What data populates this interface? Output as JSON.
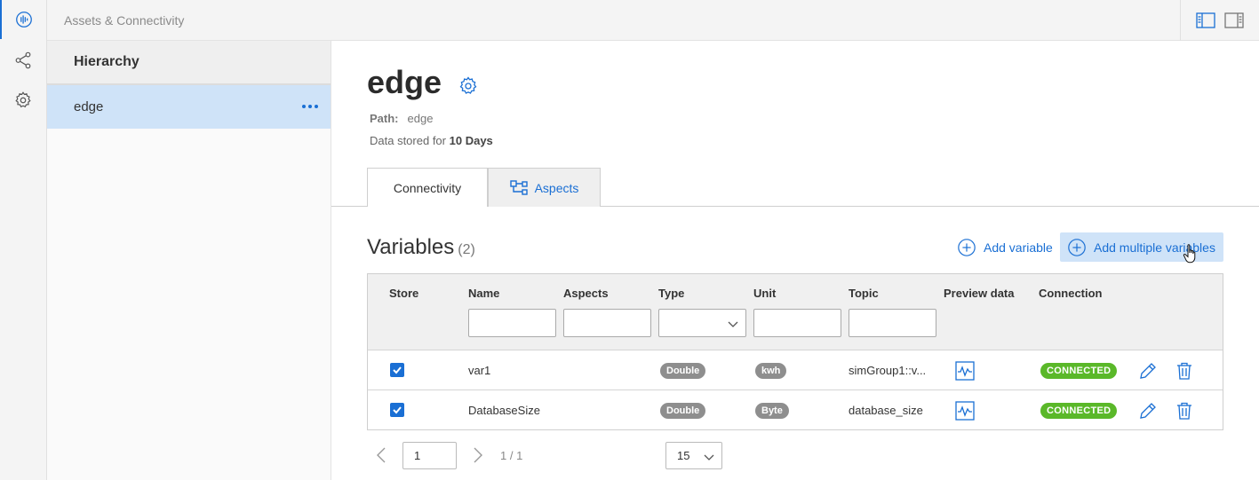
{
  "app": {
    "title": "Assets & Connectivity"
  },
  "hierarchy": {
    "heading": "Hierarchy",
    "items": [
      {
        "label": "edge"
      }
    ]
  },
  "asset": {
    "name": "edge",
    "path_label": "Path:",
    "path_value": "edge",
    "stored_prefix": "Data stored for",
    "stored_value": "10 Days"
  },
  "tabs": [
    {
      "label": "Connectivity",
      "active": true
    },
    {
      "label": "Aspects",
      "active": false
    }
  ],
  "variables": {
    "title": "Variables",
    "count": "(2)",
    "add_label": "Add variable",
    "add_multiple_label": "Add multiple variables",
    "columns": [
      "Store",
      "Name",
      "Aspects",
      "Type",
      "Unit",
      "Topic",
      "Preview data",
      "Connection"
    ],
    "rows": [
      {
        "name": "var1",
        "type": "Double",
        "unit": "kwh",
        "topic": "simGroup1::v...",
        "connection": "CONNECTED",
        "store": true
      },
      {
        "name": "DatabaseSize",
        "type": "Double",
        "unit": "Byte",
        "topic": "database_size",
        "connection": "CONNECTED",
        "store": true
      }
    ]
  },
  "pagination": {
    "page": "1",
    "total": "1 / 1",
    "page_size": "15"
  },
  "colors": {
    "accent": "#1a6fd4",
    "selected": "#cfe3f8",
    "connected": "#5ab829",
    "pill": "#8e8e8e"
  }
}
